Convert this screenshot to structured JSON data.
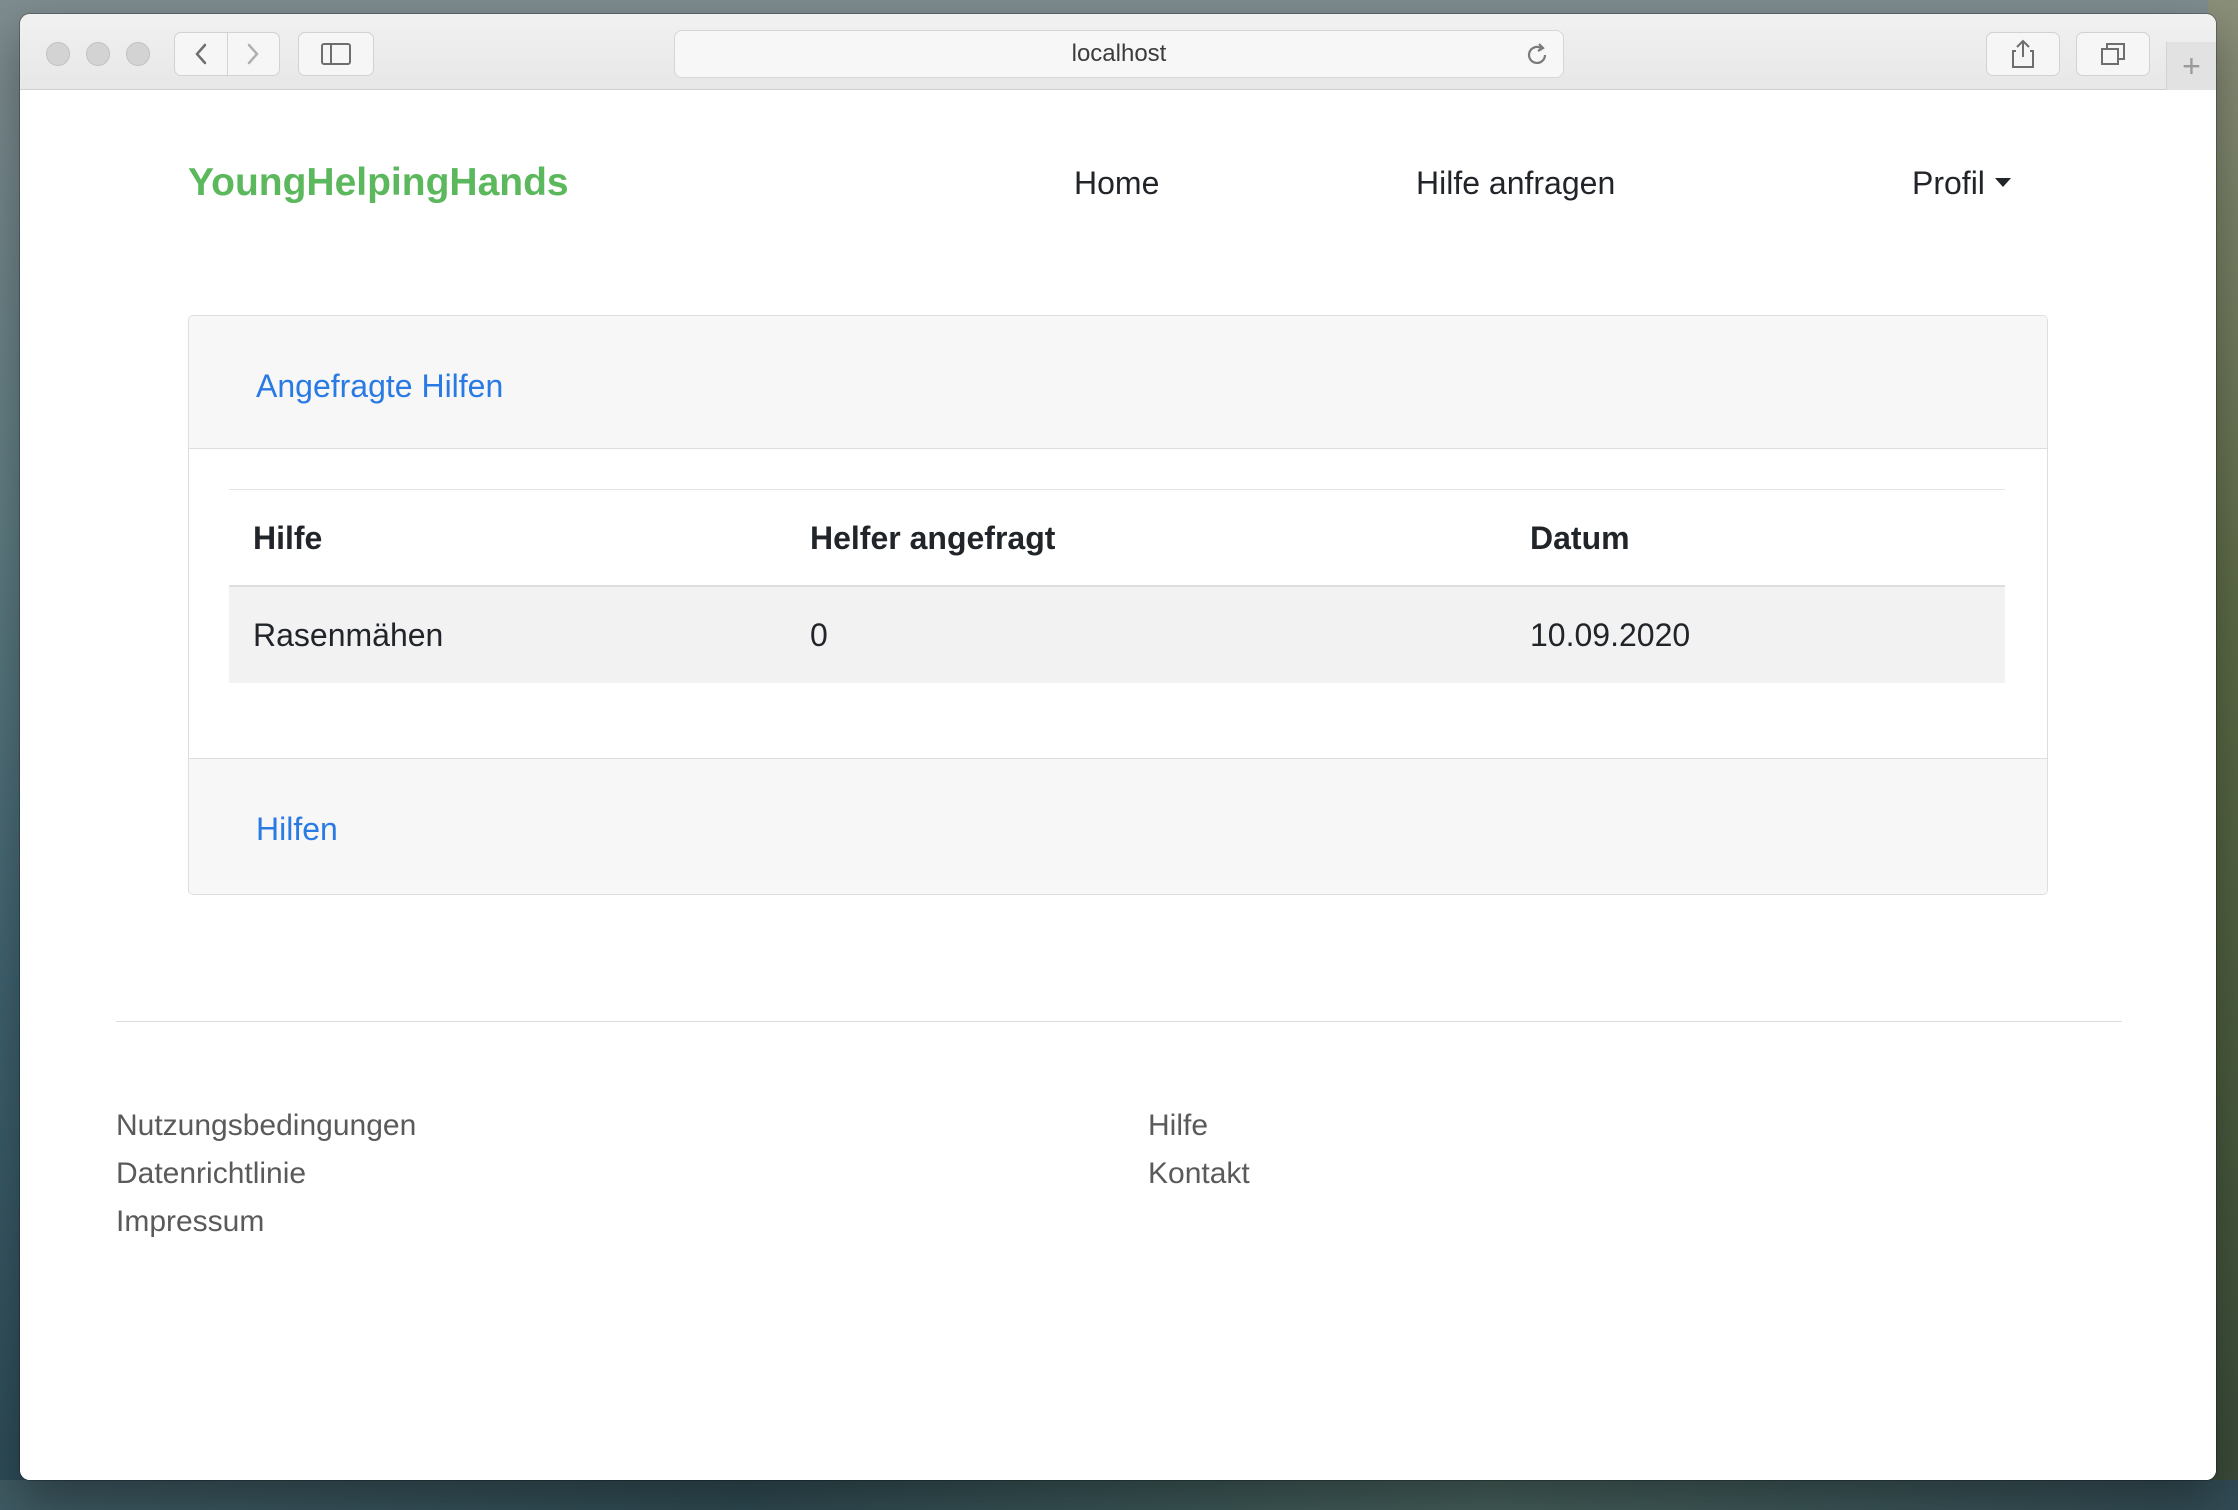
{
  "browser": {
    "address": "localhost"
  },
  "nav": {
    "brand": "YoungHelpingHands",
    "home": "Home",
    "request_help": "Hilfe anfragen",
    "profile": "Profil"
  },
  "card": {
    "header_title": "Angefragte Hilfen",
    "columns": [
      "Hilfe",
      "Helfer angefragt",
      "Datum"
    ],
    "rows": [
      [
        "Rasenmähen",
        "0",
        "10.09.2020"
      ]
    ],
    "footer_title": "Hilfen"
  },
  "footer": {
    "left": [
      "Nutzungsbedingungen",
      "Datenrichtlinie",
      "Impressum"
    ],
    "right": [
      "Hilfe",
      "Kontakt"
    ]
  },
  "colors": {
    "brand": "#5cb85c",
    "link": "#2a7ae4"
  }
}
